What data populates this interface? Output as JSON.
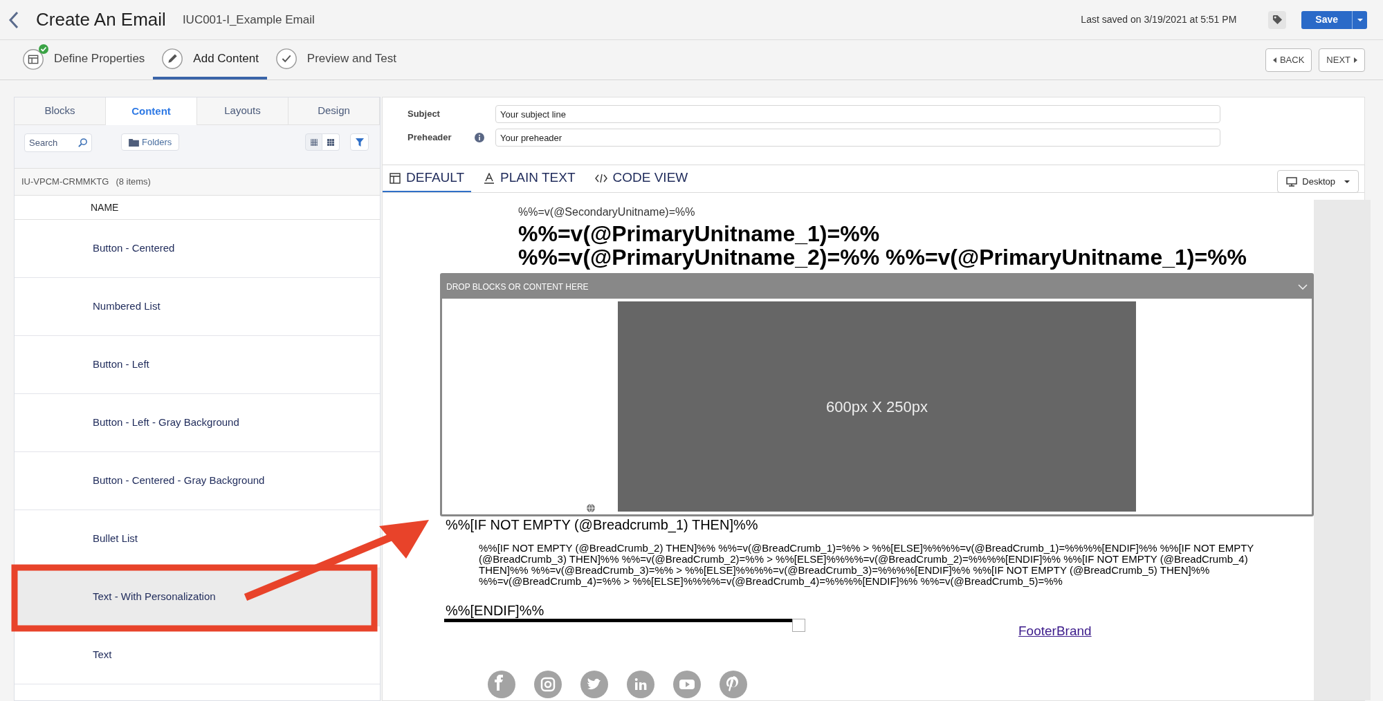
{
  "header": {
    "title": "Create An Email",
    "subtitle": "IUC001-I_Example Email",
    "last_saved": "Last saved on 3/19/2021 at 5:51 PM",
    "save_label": "Save"
  },
  "steps": [
    {
      "label": "Define Properties",
      "kind": "properties",
      "selected": false,
      "completed": true
    },
    {
      "label": "Add Content",
      "kind": "edit",
      "selected": true,
      "completed": false
    },
    {
      "label": "Preview and Test",
      "kind": "check",
      "selected": false,
      "completed": false
    }
  ],
  "nav_buttons": [
    {
      "label": "BACK",
      "kind": "back"
    },
    {
      "label": "NEXT",
      "kind": "next"
    }
  ],
  "library": {
    "tabs": [
      {
        "label": "Blocks",
        "selected": false
      },
      {
        "label": "Content",
        "selected": true
      },
      {
        "label": "Layouts",
        "selected": false
      },
      {
        "label": "Design",
        "selected": false
      }
    ],
    "search": {
      "placeholder": "Search"
    },
    "folders_label": "Folders",
    "folder": "IU-VPCM-CRMMKTG",
    "item_count": "(8 items)",
    "column": "NAME",
    "items": [
      {
        "label": "Button - Centered",
        "selected": false
      },
      {
        "label": "Numbered List",
        "selected": false
      },
      {
        "label": "Button - Left",
        "selected": false
      },
      {
        "label": "Button - Left - Gray Background",
        "selected": false
      },
      {
        "label": "Button - Centered - Gray Background",
        "selected": false
      },
      {
        "label": "Bullet List",
        "selected": false
      },
      {
        "label": "Text - With Personalization",
        "selected": true
      },
      {
        "label": "Text",
        "selected": false
      }
    ]
  },
  "editor": {
    "fields": [
      {
        "label": "Subject",
        "value": "Your subject line",
        "info": false
      },
      {
        "label": "Preheader",
        "value": "Your preheader",
        "info": true
      }
    ],
    "view_tabs": [
      {
        "label": "DEFAULT",
        "kind": "default",
        "selected": true
      },
      {
        "label": "PLAIN TEXT",
        "kind": "plain",
        "selected": false
      },
      {
        "label": "CODE VIEW",
        "kind": "code",
        "selected": false
      }
    ],
    "device": "Desktop"
  },
  "email": {
    "secondary": "%%=v(@SecondaryUnitname)=%%",
    "primary_lines": [
      "%%=v(@PrimaryUnitname_1)=%%",
      "%%=v(@PrimaryUnitname_2)=%% %%=v(@PrimaryUnitname_1)=%%"
    ],
    "drop_zone": {
      "label": "DROP BLOCKS OR CONTENT HERE",
      "image_label": "600px X 250px"
    },
    "condition_start": "%%[IF NOT EMPTY (@Breadcrumb_1) THEN]%%",
    "breadcrumb_code": "%%[IF NOT EMPTY (@BreadCrumb_2) THEN]%% %%=v(@BreadCrumb_1)=%% > %%[ELSE]%%%%=v(@BreadCrumb_1)=%%%%[ENDIF]%% %%[IF NOT EMPTY (@BreadCrumb_3) THEN]%% %%=v(@BreadCrumb_2)=%% > %%[ELSE]%%%%=v(@BreadCrumb_2)=%%%%[ENDIF]%% %%[IF NOT EMPTY (@BreadCrumb_4) THEN]%% %%=v(@BreadCrumb_3)=%% > %%[ELSE]%%%%=v(@BreadCrumb_3)=%%%%[ENDIF]%% %%[IF NOT EMPTY (@BreadCrumb_5) THEN]%% %%=v(@BreadCrumb_4)=%% > %%[ELSE]%%%%=v(@BreadCrumb_4)=%%%%[ENDIF]%% %%=v(@BreadCrumb_5)=%%",
    "condition_end": "%%[ENDIF]%%",
    "footer_link": "FooterBrand"
  }
}
